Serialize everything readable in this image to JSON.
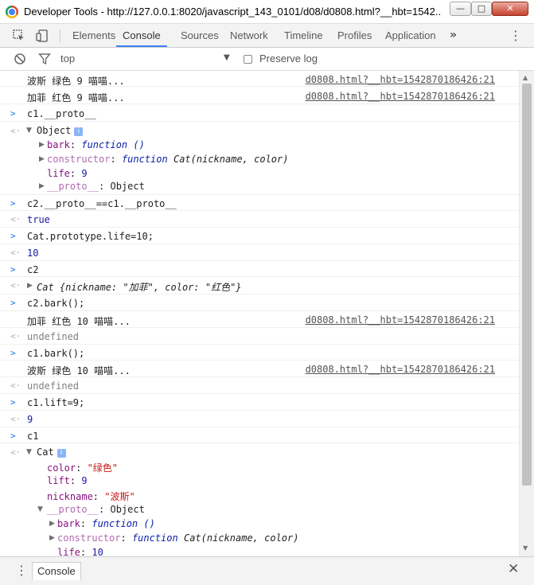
{
  "window": {
    "title": "Developer Tools - http://127.0.0.1:8020/javascript_143_0101/d08/d0808.html?__hbt=1542...",
    "min_glyph": "—",
    "max_glyph": "□",
    "close_glyph": "✕"
  },
  "toolbar": {
    "tabs": [
      "Elements",
      "Console",
      "Sources",
      "Network",
      "Timeline",
      "Profiles",
      "Application"
    ],
    "active_tab": "Console",
    "more_glyph": "»",
    "menu_glyph": "⋮"
  },
  "filter": {
    "context": "top",
    "context_arrow": "▼",
    "preserve_log_label": "Preserve log",
    "preserve_log_checked": false
  },
  "console": {
    "source_link": "d0808.html?__hbt=1542870186426:21",
    "log1": "波斯 绿色 9 喵喵...",
    "log2": "加菲 红色 9 喵喵...",
    "in1": "c1.__proto__",
    "obj1_label": "Object",
    "obj1_bark_key": "bark",
    "obj1_bark_val": "function ()",
    "obj1_ctor_key": "constructor",
    "obj1_ctor_kw": "function",
    "obj1_ctor_sig": "Cat(nickname, color)",
    "obj1_life_key": "life",
    "obj1_life_val": "9",
    "obj1_proto_key": "__proto__",
    "obj1_proto_val": "Object",
    "in2": "c2.__proto__==c1.__proto__",
    "out2": "true",
    "in3": "Cat.prototype.life=10;",
    "out3": "10",
    "in4": "c2",
    "out4": "Cat {nickname: \"加菲\", color: \"红色\"}",
    "in5": "c2.bark();",
    "log5": "加菲 红色 10 喵喵...",
    "out5": "undefined",
    "in6": "c1.bark();",
    "log6": "波斯 绿色 10 喵喵...",
    "out6": "undefined",
    "in7": "c1.lift=9;",
    "out7": "9",
    "in8": "c1",
    "obj8_label": "Cat",
    "obj8_color_key": "color",
    "obj8_color_val": "\"绿色\"",
    "obj8_lift_key": "lift",
    "obj8_lift_val": "9",
    "obj8_nick_key": "nickname",
    "obj8_nick_val": "\"波斯\"",
    "obj8_proto_key": "__proto__",
    "obj8_proto_val": "Object",
    "obj8_bark_key": "bark",
    "obj8_bark_val": "function ()",
    "obj8_ctor_key": "constructor",
    "obj8_ctor_kw": "function",
    "obj8_ctor_sig": "Cat(nickname, color)",
    "obj8_life_key": "life",
    "obj8_life_val": "10",
    "info_glyph": "i",
    "prompt_glyph": ">",
    "result_glyph": "<·"
  },
  "drawer": {
    "menu_glyph": "⋮",
    "tab_label": "Console",
    "close_glyph": "✕"
  },
  "colors": {
    "accent": "#3e82f7",
    "property_key": "#881280",
    "string": "#c41a16",
    "number": "#1a1aa6"
  }
}
